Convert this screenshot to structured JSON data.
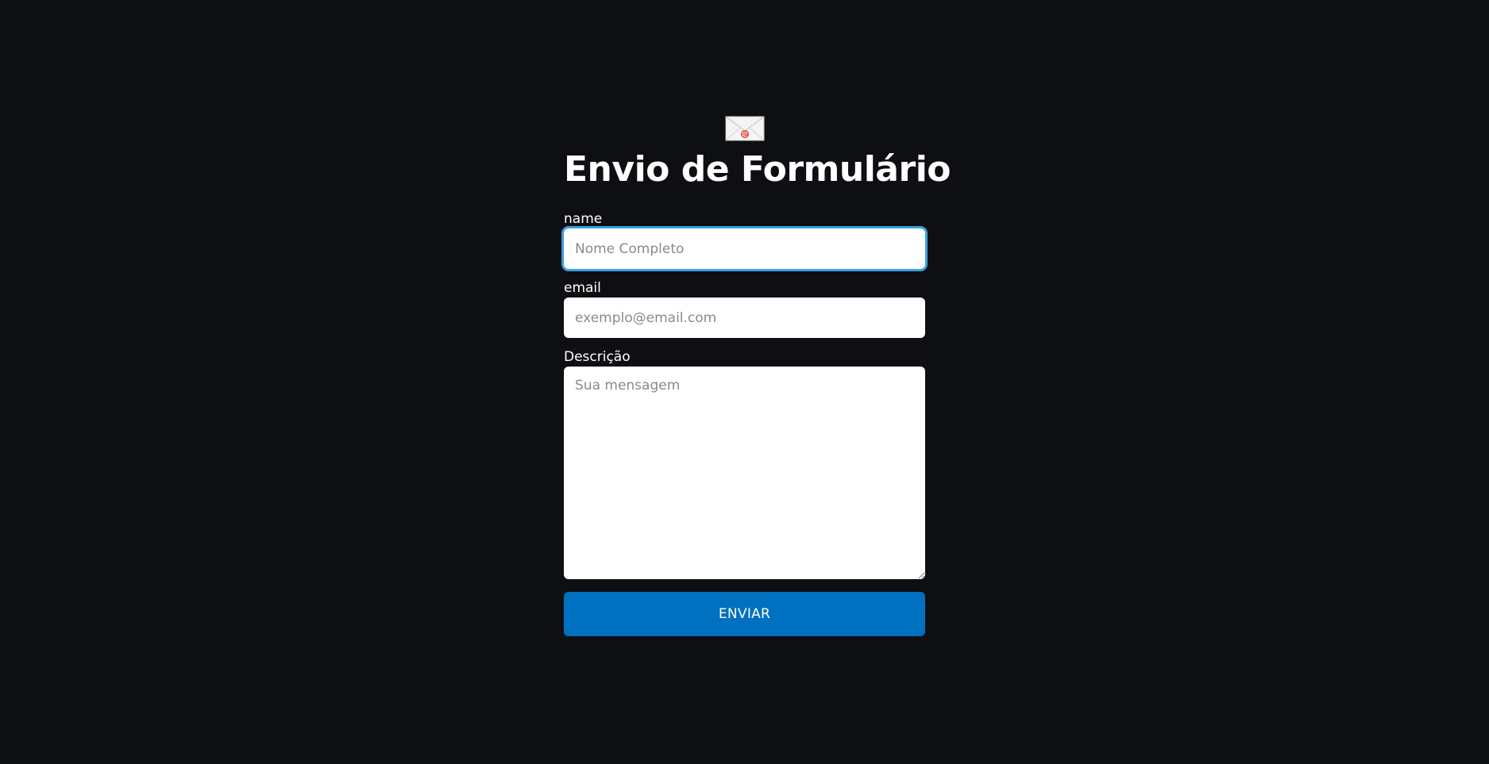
{
  "header": {
    "icon": "envelope-icon",
    "title": "Envio de Formulário"
  },
  "form": {
    "name": {
      "label": "name",
      "placeholder": "Nome Completo",
      "value": ""
    },
    "email": {
      "label": "email",
      "placeholder": "exemplo@email.com",
      "value": ""
    },
    "description": {
      "label": "Descrição",
      "placeholder": "Sua mensagem",
      "value": ""
    },
    "submit_label": "ENVIAR"
  },
  "colors": {
    "background": "#0d0f12",
    "accent": "#0070c0",
    "focus_ring": "#3aa0e0",
    "text": "#ffffff"
  }
}
